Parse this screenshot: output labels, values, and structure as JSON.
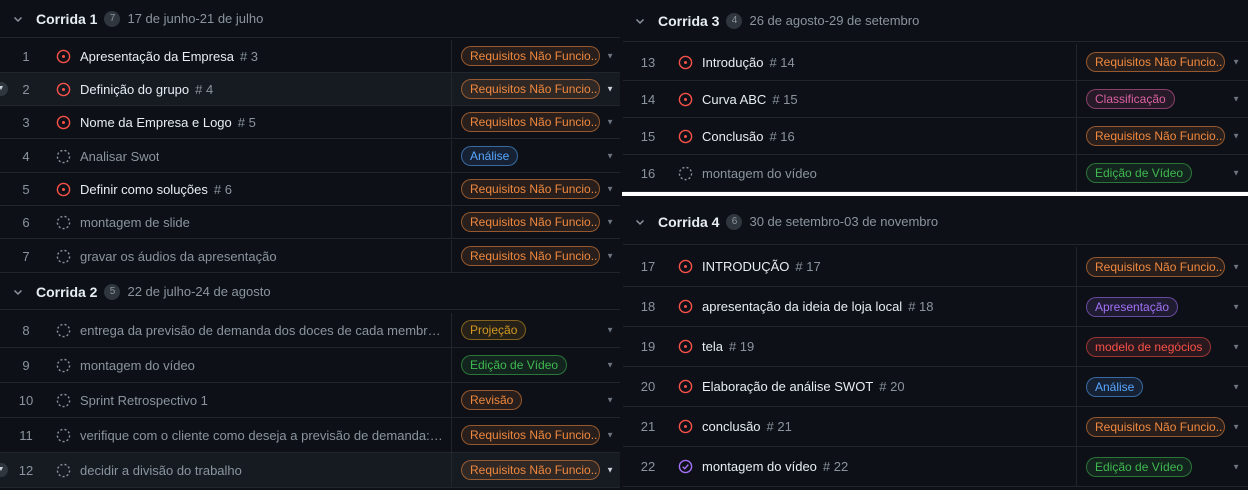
{
  "colors": {
    "req": "#f0883e",
    "analise": "#58a6ff",
    "projecao": "#d29922",
    "edicao": "#3fb950",
    "revisao": "#f0883e",
    "classificacao": "#db61a2",
    "apresentacao": "#a371f7",
    "modelo": "#f85149",
    "open": "#f85149",
    "draft": "#8b949e",
    "done": "#a371f7"
  },
  "left": {
    "groups": [
      {
        "title": "Corrida 1",
        "count": "7",
        "dates": "17 de junho-21 de julho",
        "items": [
          {
            "num": "1",
            "title": "Apresentação da Empresa",
            "ref": "# 3",
            "status": "open",
            "label": "Requisitos Não Funcio...",
            "labelType": "req"
          },
          {
            "num": "2",
            "title": "Definição do grupo",
            "ref": "# 4",
            "status": "open",
            "label": "Requisitos Não Funcio...",
            "labelType": "req"
          },
          {
            "num": "3",
            "title": "Nome da Empresa e Logo",
            "ref": "# 5",
            "status": "open",
            "label": "Requisitos Não Funcio...",
            "labelType": "req"
          },
          {
            "num": "4",
            "title": "Analisar Swot",
            "ref": "",
            "status": "draft",
            "label": "Análise",
            "labelType": "analise"
          },
          {
            "num": "5",
            "title": "Definir como soluções",
            "ref": "# 6",
            "status": "open",
            "label": "Requisitos Não Funcio...",
            "labelType": "req"
          },
          {
            "num": "6",
            "title": "montagem de slide",
            "ref": "",
            "status": "draft",
            "label": "Requisitos Não Funcio...",
            "labelType": "req"
          },
          {
            "num": "7",
            "title": "gravar os áudios da apresentação",
            "ref": "",
            "status": "draft",
            "label": "Requisitos Não Funcio...",
            "labelType": "req"
          }
        ]
      },
      {
        "title": "Corrida 2",
        "count": "5",
        "dates": "22 de julho-24 de agosto",
        "items": [
          {
            "num": "8",
            "title": "entrega da previsão de demanda dos doces de cada membro d...",
            "ref": "",
            "status": "draft",
            "label": "Projeção",
            "labelType": "projecao"
          },
          {
            "num": "9",
            "title": "montagem do vídeo",
            "ref": "",
            "status": "draft",
            "label": "Edição de Vídeo",
            "labelType": "edicao"
          },
          {
            "num": "10",
            "title": "Sprint Retrospectivo 1",
            "ref": "",
            "status": "draft",
            "label": "Revisão",
            "labelType": "revisao"
          },
          {
            "num": "11",
            "title": "verifique com o cliente como deseja a previsão de demanda: de...",
            "ref": "",
            "status": "draft",
            "label": "Requisitos Não Funcio...",
            "labelType": "req"
          },
          {
            "num": "12",
            "title": "decidir a divisão do trabalho",
            "ref": "",
            "status": "draft",
            "label": "Requisitos Não Funcio...",
            "labelType": "req"
          }
        ]
      }
    ]
  },
  "right": {
    "groups": [
      {
        "title": "Corrida 3",
        "count": "4",
        "dates": "26 de agosto-29 de setembro",
        "items": [
          {
            "num": "13",
            "title": "Introdução",
            "ref": "# 14",
            "status": "open",
            "label": "Requisitos Não Funcio...",
            "labelType": "req"
          },
          {
            "num": "14",
            "title": "Curva ABC",
            "ref": "# 15",
            "status": "open",
            "label": "Classificação",
            "labelType": "classificacao"
          },
          {
            "num": "15",
            "title": "Conclusão",
            "ref": "# 16",
            "status": "open",
            "label": "Requisitos Não Funcio...",
            "labelType": "req"
          },
          {
            "num": "16",
            "title": "montagem do vídeo",
            "ref": "",
            "status": "draft",
            "label": "Edição de Vídeo",
            "labelType": "edicao"
          }
        ]
      },
      {
        "title": "Corrida 4",
        "count": "6",
        "dates": "30 de setembro-03 de novembro",
        "items": [
          {
            "num": "17",
            "title": "INTRODUÇÃO",
            "ref": "# 17",
            "status": "open",
            "label": "Requisitos Não Funcio...",
            "labelType": "req"
          },
          {
            "num": "18",
            "title": "apresentação da ideia de loja local",
            "ref": "# 18",
            "status": "open",
            "label": "Apresentação",
            "labelType": "apresentacao"
          },
          {
            "num": "19",
            "title": "tela",
            "ref": "# 19",
            "status": "open",
            "label": "modelo de negócios",
            "labelType": "modelo"
          },
          {
            "num": "20",
            "title": "Elaboração de análise SWOT",
            "ref": "# 20",
            "status": "open",
            "label": "Análise",
            "labelType": "analise"
          },
          {
            "num": "21",
            "title": "conclusão",
            "ref": "# 21",
            "status": "open",
            "label": "Requisitos Não Funcio...",
            "labelType": "req"
          },
          {
            "num": "22",
            "title": "montagem do vídeo",
            "ref": "# 22",
            "status": "done",
            "label": "Edição de Vídeo",
            "labelType": "edicao"
          }
        ]
      }
    ]
  }
}
